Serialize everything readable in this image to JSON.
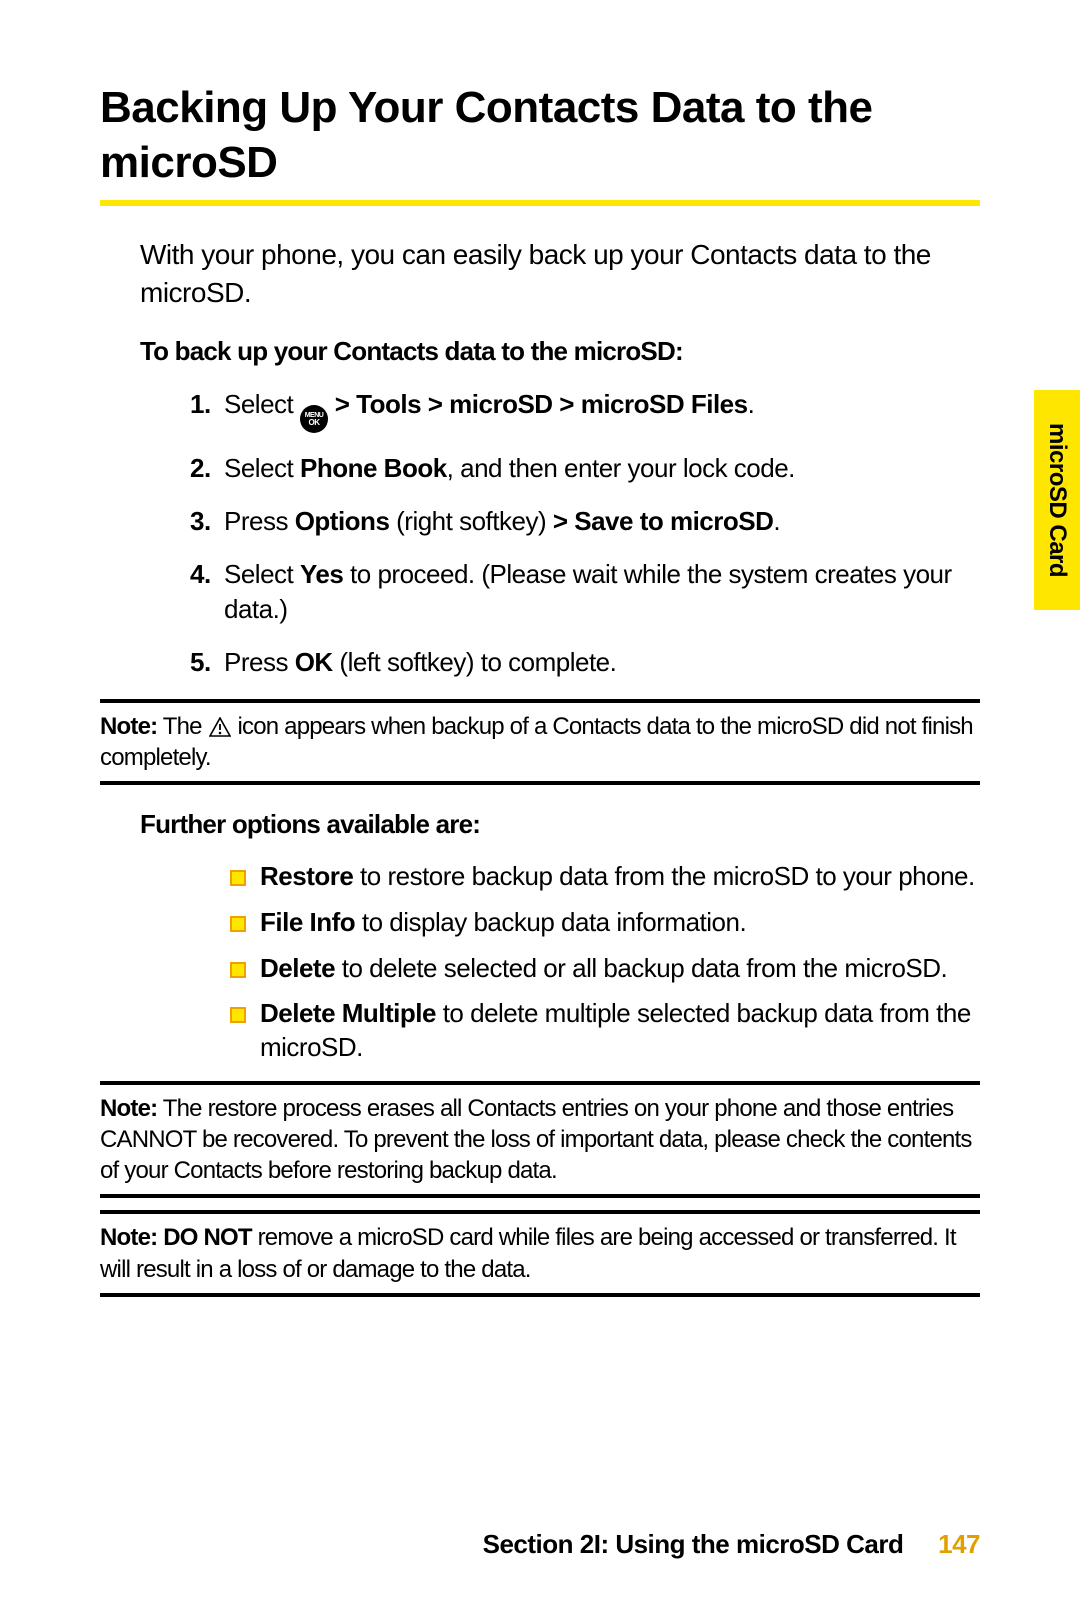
{
  "title": "Backing Up Your Contacts Data to the microSD",
  "intro": "With your phone, you can easily back up your Contacts data to the microSD.",
  "subhead1": "To back up your Contacts data to the microSD:",
  "steps": [
    {
      "n": "1.",
      "before": "Select ",
      "icon": "menu-ok",
      "after_bold": " > Tools > microSD > microSD Files",
      "tail": "."
    },
    {
      "n": "2.",
      "plain1": "Select ",
      "b1": "Phone Book",
      "plain2": ", and then enter your lock code."
    },
    {
      "n": "3.",
      "plain1": "Press ",
      "b1": "Options",
      "plain2": " (right softkey) ",
      "b2": "> Save to microSD",
      "plain3": "."
    },
    {
      "n": "4.",
      "plain1": "Select ",
      "b1": "Yes",
      "plain2": " to proceed. (Please wait while the system creates your data.)"
    },
    {
      "n": "5.",
      "plain1": "Press ",
      "b1": "OK",
      "plain2": " (left softkey) to complete."
    }
  ],
  "note1_label": "Note:",
  "note1_before": " The ",
  "note1_icon": "warning",
  "note1_after": " icon appears when backup of a Contacts data to the microSD did not finish completely.",
  "subhead2": "Further options available are:",
  "bullets": [
    {
      "b": "Restore",
      "t": " to restore backup data from the microSD to your phone."
    },
    {
      "b": "File Info",
      "t": " to display backup data information."
    },
    {
      "b": "Delete",
      "t": " to delete selected or all backup data from the microSD."
    },
    {
      "b": "Delete Multiple",
      "t": " to delete multiple selected backup data from the microSD."
    }
  ],
  "note2_label": "Note:",
  "note2_text": " The restore process erases all Contacts entries on your phone and those entries CANNOT be recovered. To prevent the loss of important data, please check the contents of your Contacts before restoring backup data.",
  "note3_label": "Note:",
  "note3_b": " DO NOT",
  "note3_text": " remove a microSD card while files are being accessed or transferred. It will result in a loss of or damage to the data.",
  "sidetab": "microSD Card",
  "footer_section": "Section 2I: Using the microSD Card",
  "footer_page": "147"
}
